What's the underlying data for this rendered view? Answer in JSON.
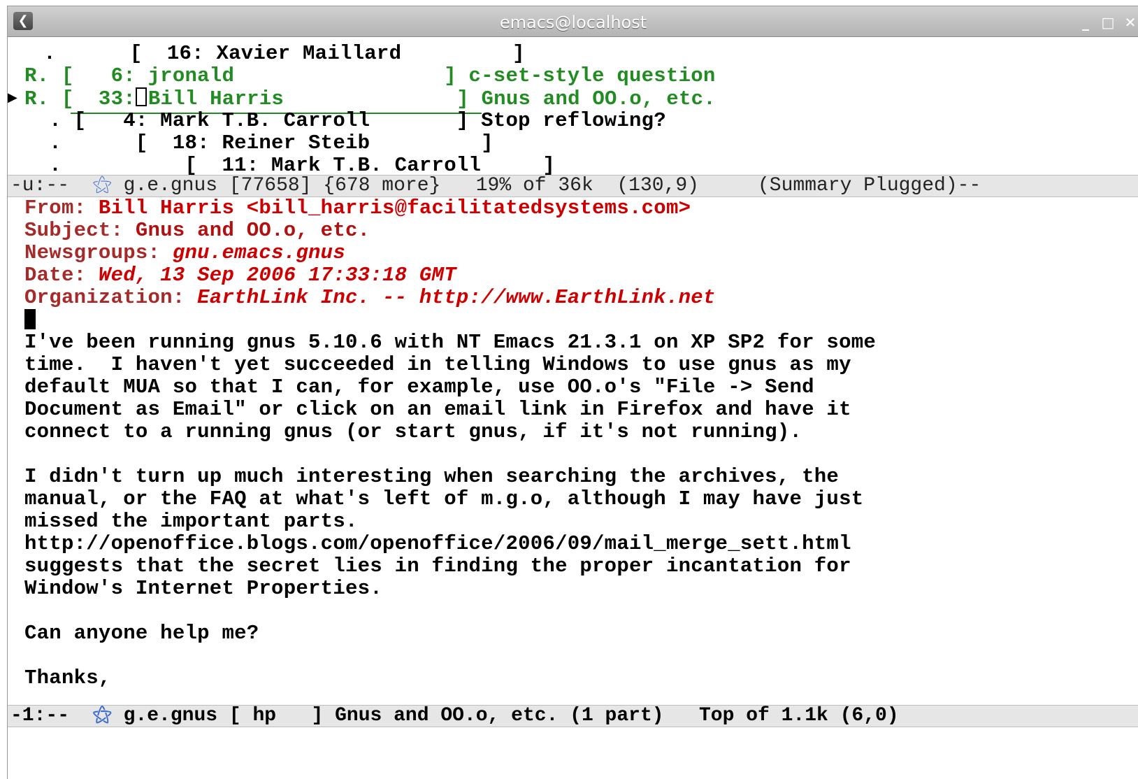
{
  "window": {
    "title": "emacs@localhost",
    "controls": {
      "minimize": "_",
      "maximize": "□",
      "close": "✕"
    }
  },
  "summary": {
    "lines": [
      {
        "mark": "  .  ",
        "text": "  .      [  16: Xavier Maillard         ]"
      },
      {
        "mark": "R.",
        "text": "R. [   6: jronald                 ] c-set-style question"
      },
      {
        "mark": "R.",
        "text_a": "R. [  33:",
        "text_b": "Bill Harris              ] Gnus and OO.o, etc."
      },
      {
        "mark": " .",
        "text": "  . [   4: Mark T.B. Carroll       ] Stop reflowing?"
      },
      {
        "mark": " .",
        "text": "  .      [  18: Reiner Steib         ]"
      },
      {
        "mark": " .",
        "text": "  .          [  11: Mark T.B. Carroll     ]"
      }
    ],
    "modeline": "-u:--  ",
    "modeline_rest": " g.e.gnus [77658] {678 more}   19% of 36k  (130,9)     (Summary Plugged)--"
  },
  "article": {
    "headers": [
      {
        "name": "From:",
        "value": " Bill Harris <bill_harris@facilitatedsystems.com>"
      },
      {
        "name": "Subject:",
        "value": " Gnus and OO.o, etc."
      },
      {
        "name": "Newsgroups:",
        "value": " gnu.emacs.gnus"
      },
      {
        "name": "Date:",
        "value": " Wed, 13 Sep 2006 17:33:18 GMT"
      },
      {
        "name": "Organization:",
        "value": " EarthLink Inc. -- http://www.EarthLink.net"
      }
    ],
    "body": [
      "I've been running gnus 5.10.6 with NT Emacs 21.3.1 on XP SP2 for some",
      "time.  I haven't yet succeeded in telling Windows to use gnus as my",
      "default MUA so that I can, for example, use OO.o's \"File -> Send",
      "Document as Email\" or click on an email link in Firefox and have it",
      "connect to a running gnus (or start gnus, if it's not running).",
      "",
      "I didn't turn up much interesting when searching the archives, the",
      "manual, or the FAQ at what's left of m.g.o, although I may have just",
      "missed the important parts.",
      "http://openoffice.blogs.com/openoffice/2006/09/mail_merge_sett.html",
      "suggests that the secret lies in finding the proper incantation for",
      "Window's Internet Properties.",
      "",
      "Can anyone help me?",
      "",
      "Thanks,"
    ],
    "modeline": "-1:--  ",
    "modeline_rest": " g.e.gnus [ hp   ] Gnus and OO.o, etc. (1 part)   Top of 1.1k (6,0)"
  }
}
